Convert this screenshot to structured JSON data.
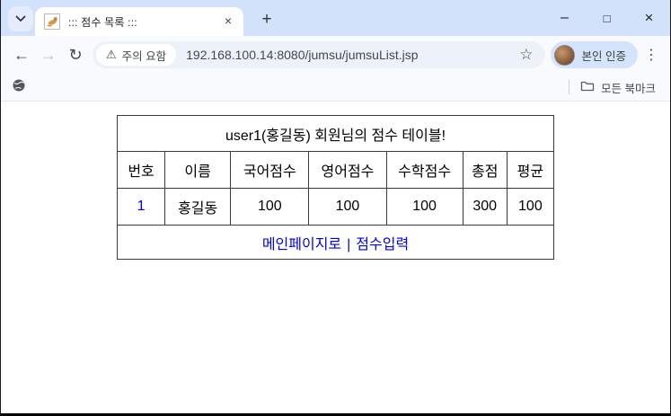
{
  "tab": {
    "title": "::: 점수 목록 :::",
    "favicon": "tomcat-logo",
    "close_icon": "×",
    "new_tab_icon": "+"
  },
  "window_controls": {
    "minimize_icon": "–",
    "maximize_icon": "□",
    "close_icon": "×"
  },
  "toolbar": {
    "back_icon": "←",
    "forward_icon": "→",
    "refresh_icon": "↻",
    "security_chip_label": "주의 요함",
    "warning_icon": "⚠",
    "url": "192.168.100.14:8080/jumsu/jumsuList.jsp",
    "star_icon": "☆",
    "profile_label": "본인 인증",
    "menu_icon": "⋮"
  },
  "bookmarks": {
    "all_bookmarks_label": "모든 북마크"
  },
  "page": {
    "table": {
      "title": "user1(홍길동) 회원님의 점수 테이블!",
      "headers": [
        "번호",
        "이름",
        "국어점수",
        "영어점수",
        "수학점수",
        "총점",
        "평균"
      ],
      "rows": [
        [
          "1",
          "홍길동",
          "100",
          "100",
          "100",
          "300",
          "100"
        ]
      ],
      "footer_links": [
        "메인페이지로",
        "점수입력"
      ],
      "footer_separator": "|"
    }
  },
  "colors": {
    "titlebar_bg": "#d3e2fb",
    "toolbar_bg": "#f8fafd",
    "omnibox_bg": "#edf1fa",
    "profile_chip_bg": "#d4e4fc",
    "link_blue": "#0000ee",
    "table_border": "#3b3b3b"
  }
}
